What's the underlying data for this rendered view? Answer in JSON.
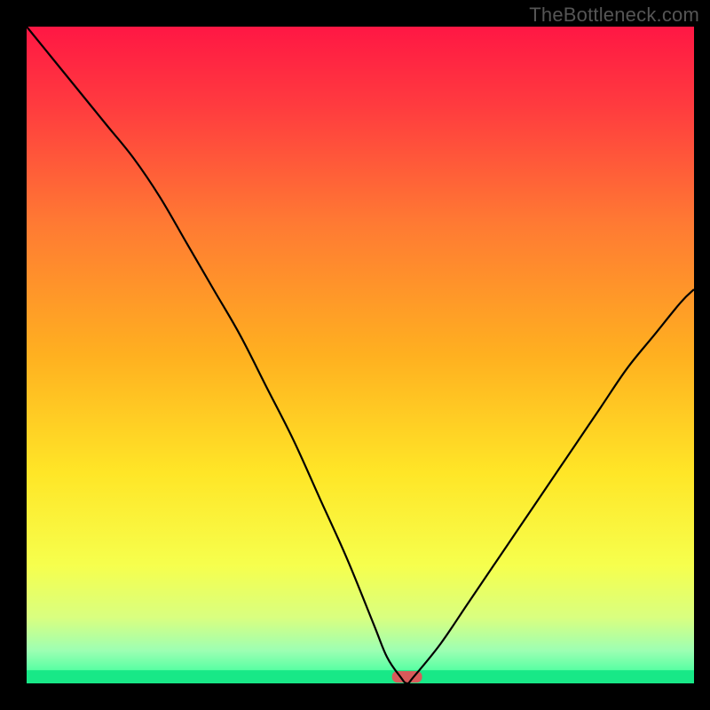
{
  "watermark": "TheBottleneck.com",
  "chart_data": {
    "type": "line",
    "title": "",
    "xlabel": "",
    "ylabel": "",
    "x_range": [
      0,
      100
    ],
    "y_range": [
      0,
      100
    ],
    "background_gradient": {
      "stops": [
        {
          "offset": 0.0,
          "color": "#ff1744"
        },
        {
          "offset": 0.12,
          "color": "#ff3b3f"
        },
        {
          "offset": 0.3,
          "color": "#ff7a33"
        },
        {
          "offset": 0.5,
          "color": "#ffb020"
        },
        {
          "offset": 0.68,
          "color": "#ffe627"
        },
        {
          "offset": 0.82,
          "color": "#f6ff4d"
        },
        {
          "offset": 0.9,
          "color": "#d9ff80"
        },
        {
          "offset": 0.95,
          "color": "#9dffb3"
        },
        {
          "offset": 1.0,
          "color": "#29ff98"
        }
      ]
    },
    "series": [
      {
        "name": "bottleneck-curve",
        "color": "#000000",
        "x": [
          0,
          4,
          8,
          12,
          16,
          20,
          24,
          28,
          32,
          36,
          40,
          44,
          48,
          52,
          54,
          56,
          57,
          58,
          62,
          66,
          70,
          74,
          78,
          82,
          86,
          90,
          94,
          98,
          100
        ],
        "y": [
          100,
          95,
          90,
          85,
          80,
          74,
          67,
          60,
          53,
          45,
          37,
          28,
          19,
          9,
          4,
          1,
          0,
          1,
          6,
          12,
          18,
          24,
          30,
          36,
          42,
          48,
          53,
          58,
          60
        ]
      }
    ],
    "marker": {
      "name": "optimal-point",
      "x": 57,
      "width": 4.5,
      "color": "#d85a5a"
    }
  }
}
